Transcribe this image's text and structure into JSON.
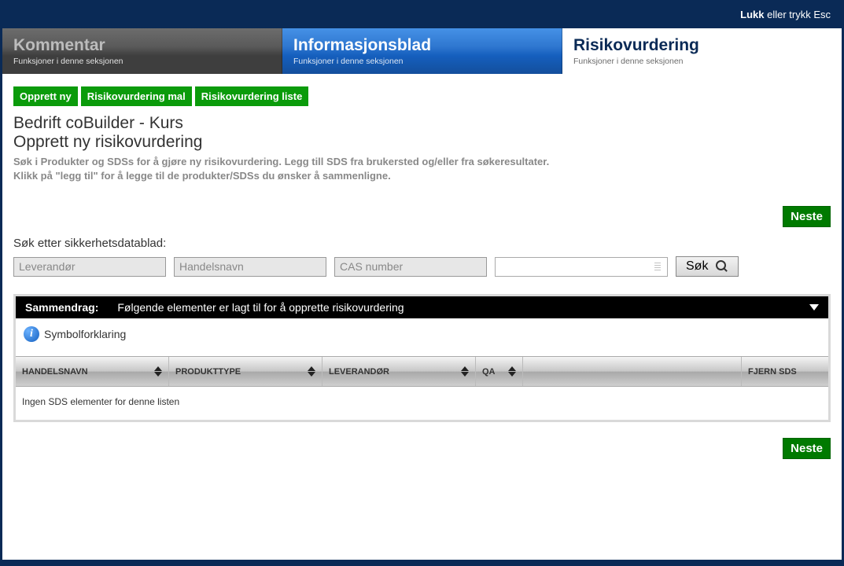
{
  "topbar": {
    "close_bold": "Lukk",
    "close_text": " eller trykk Esc"
  },
  "tabs": {
    "kommentar": {
      "title": "Kommentar",
      "sub": "Funksjoner i denne seksjonen"
    },
    "info": {
      "title": "Informasjonsblad",
      "sub": "Funksjoner i denne seksjonen"
    },
    "risiko": {
      "title": "Risikovurdering",
      "sub": "Funksjoner i denne seksjonen"
    }
  },
  "green_buttons": [
    "Opprett ny",
    "Risikovurdering mal",
    "Risikovurdering liste"
  ],
  "heading1": "Bedrift coBuilder - Kurs",
  "heading2": "Opprett ny risikovurdering",
  "instructions_line1": "Søk i Produkter og SDSs for å gjøre ny risikovurdering. Legg till SDS fra brukersted og/eller fra søkeresultater.",
  "instructions_line2": "Klikk på \"legg til\" for å legge til de produkter/SDSs du ønsker å sammenligne.",
  "next_label": "Neste",
  "search_label": "Søk etter sikkerhetsdatablad:",
  "search_fields": {
    "supplier_placeholder": "Leverandør",
    "tradename_placeholder": "Handelsnavn",
    "cas_placeholder": "CAS number",
    "search_button": "Søk"
  },
  "summary": {
    "label": "Sammendrag:",
    "text": "Følgende elementer er lagt til for å opprette risikovurdering",
    "legend": "Symbolforklaring"
  },
  "table": {
    "headers": {
      "handelsnavn": "HANDELSNAVN",
      "produkttype": "PRODUKTTYPE",
      "leverandor": "LEVERANDØR",
      "qa": "QA",
      "fjern": "FJERN SDS"
    },
    "empty_text": "Ingen SDS elementer for denne listen"
  }
}
